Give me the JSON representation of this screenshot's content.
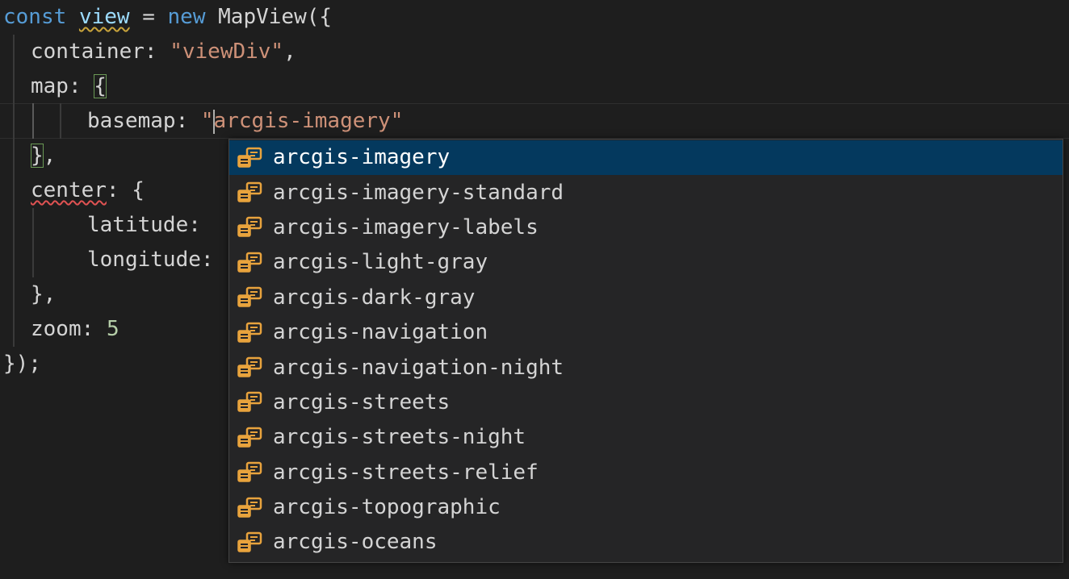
{
  "editor": {
    "lines": [
      {
        "tokens": [
          {
            "text": "const",
            "kind": "kw"
          },
          {
            "text": " ",
            "kind": "plain"
          },
          {
            "text": "view",
            "kind": "var",
            "squiggle": "warn"
          },
          {
            "text": " = ",
            "kind": "plain"
          },
          {
            "text": "new",
            "kind": "kw"
          },
          {
            "text": " MapView({",
            "kind": "cls"
          }
        ]
      },
      {
        "tokens": [
          {
            "text": "container",
            "kind": "prop"
          },
          {
            "text": ": ",
            "kind": "plain"
          },
          {
            "text": "\"viewDiv\"",
            "kind": "str"
          },
          {
            "text": ",",
            "kind": "plain"
          }
        ]
      },
      {
        "tokens": [
          {
            "text": "map",
            "kind": "prop"
          },
          {
            "text": ": ",
            "kind": "plain"
          },
          {
            "text": "{",
            "kind": "plain",
            "bracket": true
          }
        ]
      },
      {
        "tokens": [
          {
            "text": "basemap",
            "kind": "prop"
          },
          {
            "text": ": ",
            "kind": "plain"
          },
          {
            "text": "\"",
            "kind": "str"
          },
          {
            "text": "arcgis-imagery",
            "kind": "str",
            "selected": true
          },
          {
            "text": "\"",
            "kind": "str"
          }
        ]
      },
      {
        "tokens": [
          {
            "text": "}",
            "kind": "plain",
            "bracket": true
          },
          {
            "text": ",",
            "kind": "plain"
          }
        ]
      },
      {
        "tokens": [
          {
            "text": "center",
            "kind": "prop",
            "squiggle": "err"
          },
          {
            "text": ": {",
            "kind": "plain"
          }
        ]
      },
      {
        "tokens": [
          {
            "text": "latitude",
            "kind": "prop"
          },
          {
            "text": ":",
            "kind": "plain"
          }
        ]
      },
      {
        "tokens": [
          {
            "text": "longitude",
            "kind": "prop"
          },
          {
            "text": ":",
            "kind": "plain"
          }
        ]
      },
      {
        "tokens": [
          {
            "text": "},",
            "kind": "plain"
          }
        ]
      },
      {
        "tokens": [
          {
            "text": "zoom",
            "kind": "prop"
          },
          {
            "text": ": ",
            "kind": "plain"
          },
          {
            "text": "5",
            "kind": "num"
          }
        ]
      },
      {
        "tokens": [
          {
            "text": "});",
            "kind": "plain"
          }
        ]
      }
    ]
  },
  "suggest": {
    "icon": "enum-member-icon",
    "icon_color": "#e8a33d",
    "focused_bg": "#04395e",
    "items": [
      "arcgis-imagery",
      "arcgis-imagery-standard",
      "arcgis-imagery-labels",
      "arcgis-light-gray",
      "arcgis-dark-gray",
      "arcgis-navigation",
      "arcgis-navigation-night",
      "arcgis-streets",
      "arcgis-streets-night",
      "arcgis-streets-relief",
      "arcgis-topographic",
      "arcgis-oceans"
    ]
  }
}
